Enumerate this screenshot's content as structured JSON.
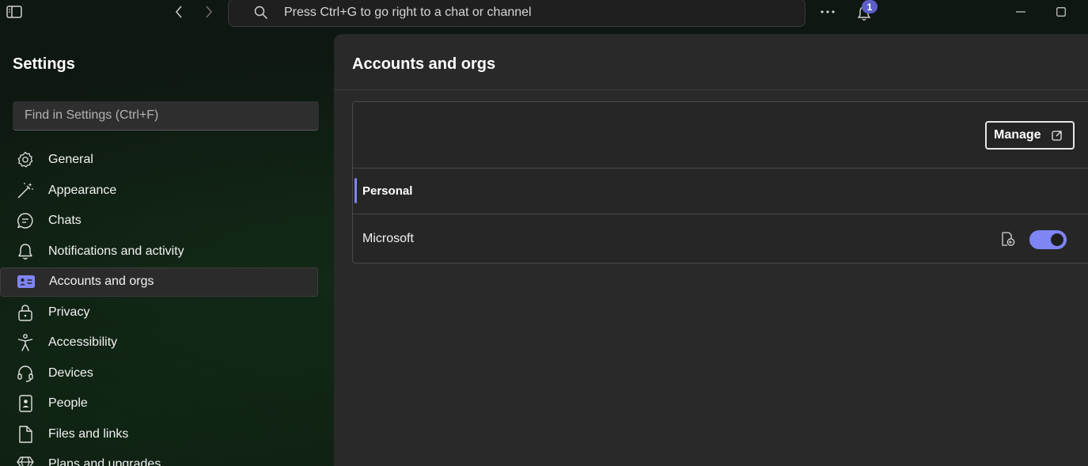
{
  "titlebar": {
    "search_placeholder": "Press Ctrl+G to go right to a chat or channel",
    "notification_count": "1"
  },
  "sidebar": {
    "title": "Settings",
    "find_placeholder": "Find in Settings (Ctrl+F)",
    "items": [
      {
        "label": "General",
        "icon": "gear-icon"
      },
      {
        "label": "Appearance",
        "icon": "magic-wand-icon"
      },
      {
        "label": "Chats",
        "icon": "chat-bubble-icon"
      },
      {
        "label": "Notifications and activity",
        "icon": "bell-icon"
      },
      {
        "label": "Accounts and orgs",
        "icon": "contact-card-icon",
        "active": true
      },
      {
        "label": "Privacy",
        "icon": "lock-icon"
      },
      {
        "label": "Accessibility",
        "icon": "accessibility-person-icon"
      },
      {
        "label": "Devices",
        "icon": "headset-icon"
      },
      {
        "label": "People",
        "icon": "contact-book-icon"
      },
      {
        "label": "Files and links",
        "icon": "document-icon"
      },
      {
        "label": "Plans and upgrades",
        "icon": "diamond-icon"
      }
    ]
  },
  "main": {
    "title": "Accounts and orgs",
    "manage_label": "Manage",
    "section_label": "Personal",
    "account_name": "Microsoft",
    "account_toggle_on": true
  },
  "colors": {
    "accent": "#7f85f5",
    "badge": "#5b5fc7",
    "panel": "#292929"
  }
}
